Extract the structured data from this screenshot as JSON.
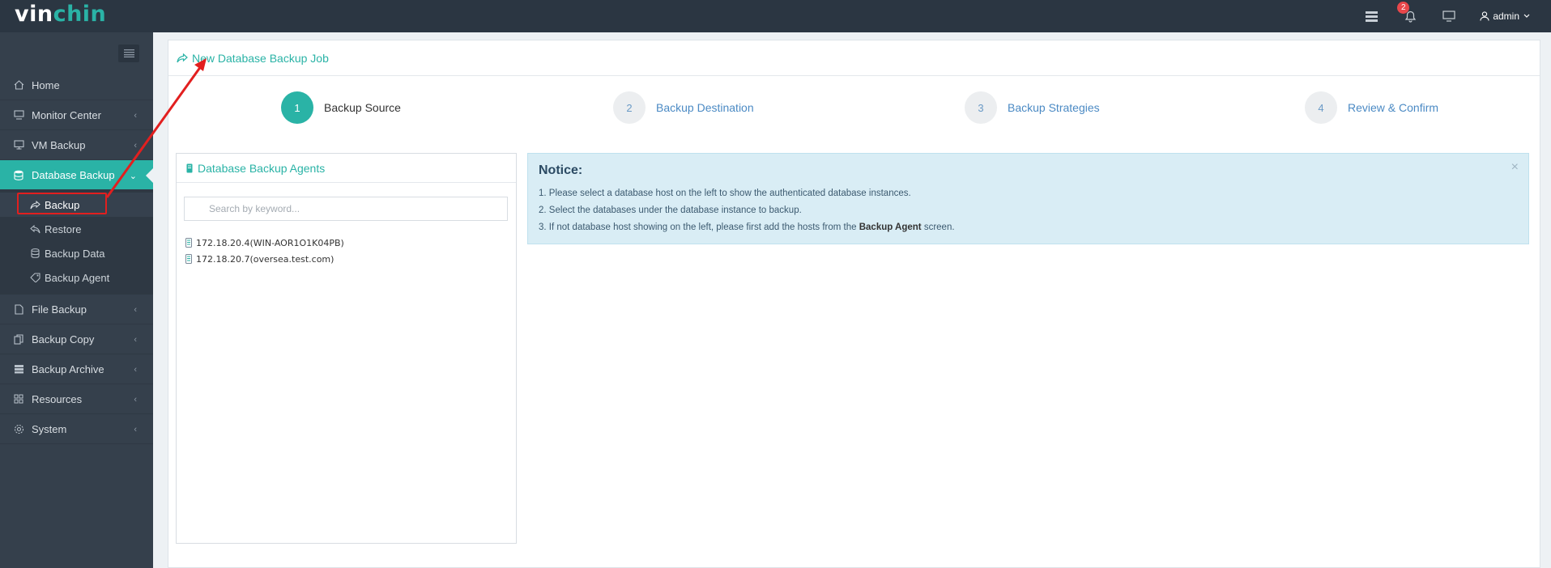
{
  "app": {
    "logo_part1": "vin",
    "logo_part2": "chin",
    "notification_count": "2",
    "user": "admin"
  },
  "sidebar": {
    "items": [
      {
        "label": "Home",
        "icon": "home-icon"
      },
      {
        "label": "Monitor Center",
        "icon": "monitor-icon"
      },
      {
        "label": "VM Backup",
        "icon": "desktop-icon"
      },
      {
        "label": "Database Backup",
        "icon": "database-icon",
        "active": true
      },
      {
        "label": "File Backup",
        "icon": "file-icon"
      },
      {
        "label": "Backup Copy",
        "icon": "copy-icon"
      },
      {
        "label": "Backup Archive",
        "icon": "archive-icon"
      },
      {
        "label": "Resources",
        "icon": "resources-icon"
      },
      {
        "label": "System",
        "icon": "gear-icon"
      }
    ],
    "sub_items": [
      {
        "label": "Backup",
        "icon": "share-icon",
        "current": true
      },
      {
        "label": "Restore",
        "icon": "reply-icon"
      },
      {
        "label": "Backup Data",
        "icon": "database-icon"
      },
      {
        "label": "Backup Agent",
        "icon": "tag-icon"
      }
    ]
  },
  "page": {
    "title": "New Database Backup Job"
  },
  "steps": [
    {
      "number": "1",
      "label": "Backup Source",
      "active": true
    },
    {
      "number": "2",
      "label": "Backup Destination"
    },
    {
      "number": "3",
      "label": "Backup Strategies"
    },
    {
      "number": "4",
      "label": "Review & Confirm"
    }
  ],
  "agents_panel": {
    "title": "Database Backup Agents",
    "search_placeholder": "Search by keyword...",
    "hosts": [
      "172.18.20.4(WIN-AOR1O1K04PB)",
      "172.18.20.7(oversea.test.com)"
    ]
  },
  "notice": {
    "title": "Notice:",
    "line1": "1. Please select a database host on the left to show the authenticated database instances.",
    "line2": "2. Select the databases under the database instance to backup.",
    "line3_before": "3. If not database host showing on the left, please first add the hosts from the",
    "line3_bold": "Backup Agent",
    "line3_after": "screen.",
    "close": "×"
  },
  "colors": {
    "accent": "#2ab3a6",
    "topbar": "#2b3642",
    "sidebar": "#35404c",
    "notice_bg": "#d9edf5",
    "annotation": "#e21f1f"
  }
}
